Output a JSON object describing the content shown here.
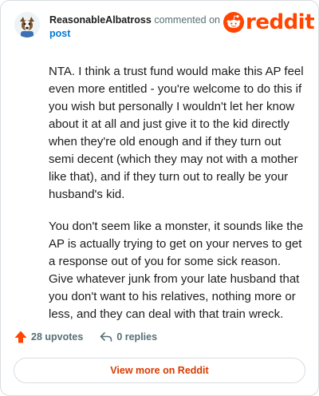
{
  "header": {
    "username": "ReasonableAlbatross",
    "meta_text": "commented on",
    "post_link": "post"
  },
  "logo": {
    "text": "reddit",
    "icon": "reddit-snoo-icon",
    "color": "#ff4500"
  },
  "comment": {
    "paragraphs": [
      "NTA. I think a trust fund would make this AP feel even more entitled - you're welcome to do this if you wish but personally I wouldn't let her know about it at all and just give it to the kid directly when they're old enough and if they turn out semi decent (which they may not with a mother like that), and if they turn out to really be your husband's kid.",
      "You don't seem like a monster, it sounds like the AP is actually trying to get on your nerves to get a response out of you for some sick reason. Give whatever junk from your late husband that you don't want to his relatives, nothing more or less, and they can deal with that train wreck."
    ]
  },
  "actions": {
    "upvotes_label": "28 upvotes",
    "replies_label": "0 replies"
  },
  "footer": {
    "button_label": "View more on Reddit",
    "accent": "#d93a00"
  }
}
